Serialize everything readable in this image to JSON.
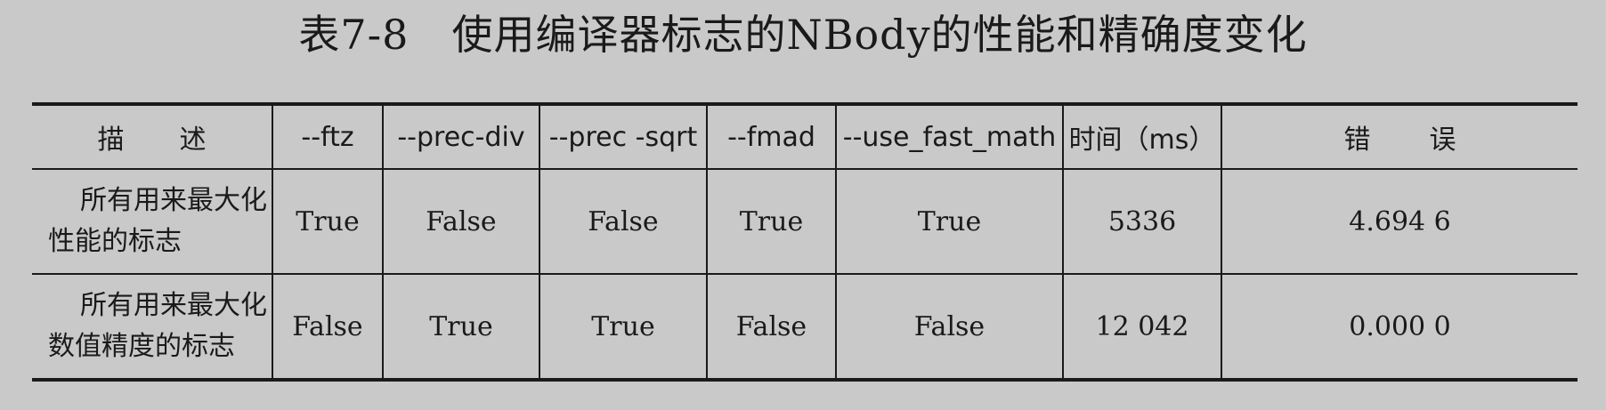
{
  "caption": {
    "number": "表7-8",
    "title": "使用编译器标志的NBody的性能和精确度变化"
  },
  "table": {
    "headers": [
      "描述",
      "--ftz",
      "--prec-div",
      "--prec -sqrt",
      "--fmad",
      "--use_fast_math",
      "时间（ms）",
      "错误"
    ],
    "rows": [
      {
        "desc_line1": "所有用来最大化",
        "desc_line2": "性能的标志",
        "ftz": "True",
        "prec_div": "False",
        "prec_sqrt": "False",
        "fmad": "True",
        "use_fast_math": "True",
        "time_ms": "5336",
        "error": "4.694 6"
      },
      {
        "desc_line1": "所有用来最大化",
        "desc_line2": "数值精度的标志",
        "ftz": "False",
        "prec_div": "True",
        "prec_sqrt": "True",
        "fmad": "False",
        "use_fast_math": "False",
        "time_ms": "12 042",
        "error": "0.000 0"
      }
    ]
  }
}
